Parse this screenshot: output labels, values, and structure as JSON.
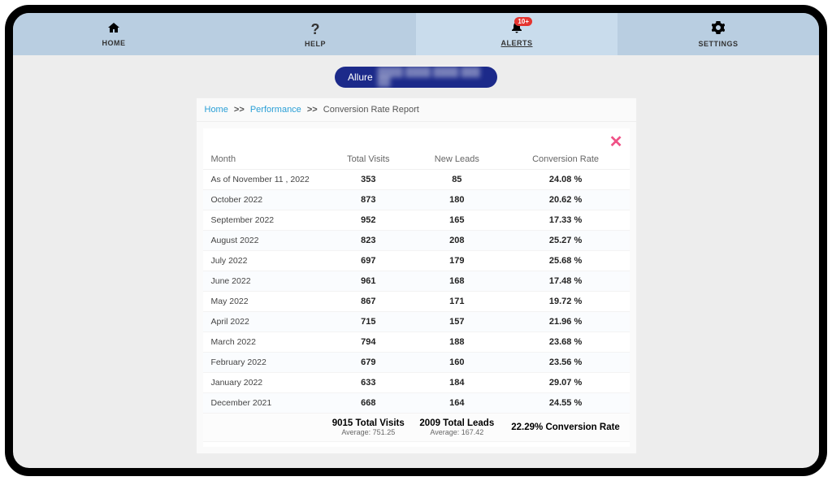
{
  "nav": {
    "home": "HOME",
    "help": "HELP",
    "alerts": "ALERTS",
    "alerts_badge": "10+",
    "settings": "SETTINGS"
  },
  "pill": {
    "label": "Allure",
    "sub": "████ ████ ████ ███ ██"
  },
  "breadcrumb": {
    "home": "Home",
    "sep": ">>",
    "performance": "Performance",
    "current": "Conversion Rate Report"
  },
  "closeChar": "✕",
  "table": {
    "headers": [
      "Month",
      "Total Visits",
      "New Leads",
      "Conversion Rate"
    ],
    "rows": [
      {
        "month": "As of November 11 , 2022",
        "visits": "353",
        "leads": "85",
        "rate": "24.08 %"
      },
      {
        "month": "October 2022",
        "visits": "873",
        "leads": "180",
        "rate": "20.62 %"
      },
      {
        "month": "September 2022",
        "visits": "952",
        "leads": "165",
        "rate": "17.33 %"
      },
      {
        "month": "August 2022",
        "visits": "823",
        "leads": "208",
        "rate": "25.27 %"
      },
      {
        "month": "July 2022",
        "visits": "697",
        "leads": "179",
        "rate": "25.68 %"
      },
      {
        "month": "June 2022",
        "visits": "961",
        "leads": "168",
        "rate": "17.48 %"
      },
      {
        "month": "May 2022",
        "visits": "867",
        "leads": "171",
        "rate": "19.72 %"
      },
      {
        "month": "April 2022",
        "visits": "715",
        "leads": "157",
        "rate": "21.96 %"
      },
      {
        "month": "March 2022",
        "visits": "794",
        "leads": "188",
        "rate": "23.68 %"
      },
      {
        "month": "February 2022",
        "visits": "679",
        "leads": "160",
        "rate": "23.56 %"
      },
      {
        "month": "January 2022",
        "visits": "633",
        "leads": "184",
        "rate": "29.07 %"
      },
      {
        "month": "December 2021",
        "visits": "668",
        "leads": "164",
        "rate": "24.55 %"
      }
    ],
    "summary": {
      "visits_total": "9015 Total Visits",
      "visits_avg": "Average: 751.25",
      "leads_total": "2009 Total Leads",
      "leads_avg": "Average: 167.42",
      "rate_total": "22.29% Conversion Rate"
    }
  },
  "chart_data": {
    "type": "table",
    "title": "Conversion Rate Report",
    "columns": [
      "Month",
      "Total Visits",
      "New Leads",
      "Conversion Rate (%)"
    ],
    "series": [
      {
        "month": "2022-11 (as of 11)",
        "visits": 353,
        "leads": 85,
        "rate": 24.08
      },
      {
        "month": "2022-10",
        "visits": 873,
        "leads": 180,
        "rate": 20.62
      },
      {
        "month": "2022-09",
        "visits": 952,
        "leads": 165,
        "rate": 17.33
      },
      {
        "month": "2022-08",
        "visits": 823,
        "leads": 208,
        "rate": 25.27
      },
      {
        "month": "2022-07",
        "visits": 697,
        "leads": 179,
        "rate": 25.68
      },
      {
        "month": "2022-06",
        "visits": 961,
        "leads": 168,
        "rate": 17.48
      },
      {
        "month": "2022-05",
        "visits": 867,
        "leads": 171,
        "rate": 19.72
      },
      {
        "month": "2022-04",
        "visits": 715,
        "leads": 157,
        "rate": 21.96
      },
      {
        "month": "2022-03",
        "visits": 794,
        "leads": 188,
        "rate": 23.68
      },
      {
        "month": "2022-02",
        "visits": 679,
        "leads": 160,
        "rate": 23.56
      },
      {
        "month": "2022-01",
        "visits": 633,
        "leads": 184,
        "rate": 29.07
      },
      {
        "month": "2021-12",
        "visits": 668,
        "leads": 164,
        "rate": 24.55
      }
    ],
    "totals": {
      "visits": 9015,
      "leads": 2009,
      "rate": 22.29
    },
    "averages": {
      "visits": 751.25,
      "leads": 167.42
    }
  }
}
